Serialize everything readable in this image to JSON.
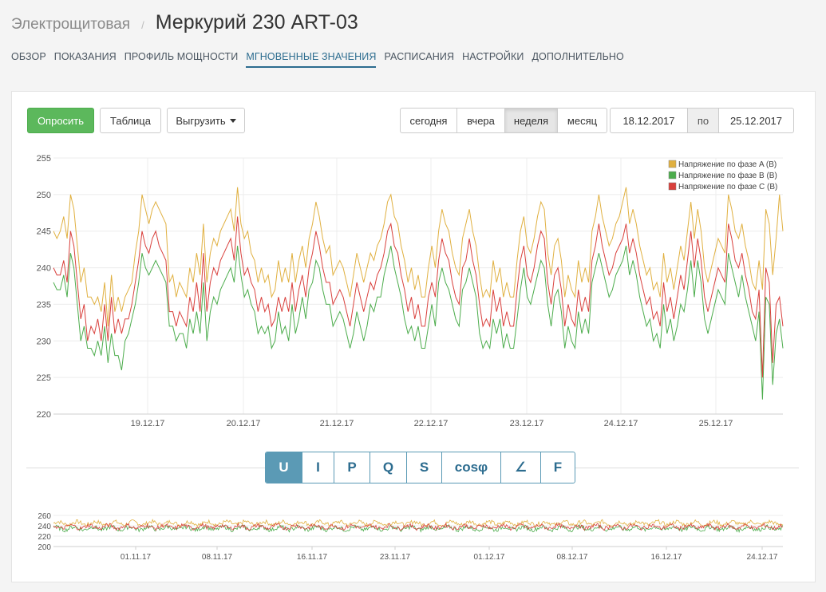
{
  "breadcrumb": {
    "parent": "Электрощитовая",
    "separator": "/",
    "title": "Меркурий 230 ART-03"
  },
  "tabs": [
    {
      "label": "ОБЗОР",
      "active": false
    },
    {
      "label": "ПОКАЗАНИЯ",
      "active": false
    },
    {
      "label": "ПРОФИЛЬ МОЩНОСТИ",
      "active": false
    },
    {
      "label": "МГНОВЕННЫЕ ЗНАЧЕНИЯ",
      "active": true
    },
    {
      "label": "РАСПИСАНИЯ",
      "active": false
    },
    {
      "label": "НАСТРОЙКИ",
      "active": false
    },
    {
      "label": "ДОПОЛНИТЕЛЬНО",
      "active": false
    }
  ],
  "toolbar": {
    "request_label": "Опросить",
    "table_label": "Таблица",
    "export_label": "Выгрузить"
  },
  "period": {
    "options": [
      "сегодня",
      "вчера",
      "неделя",
      "месяц"
    ],
    "selected": "неделя",
    "from": "18.12.2017",
    "to_label": "по",
    "to": "25.12.2017"
  },
  "params": {
    "items": [
      "U",
      "I",
      "P",
      "Q",
      "S",
      "cosφ",
      "∠",
      "F"
    ],
    "selected": "U"
  },
  "colors": {
    "phase_a": "#e0b040",
    "phase_b": "#4cac4c",
    "phase_c": "#d9403c",
    "accent": "#5b9ab5",
    "primary": "#5cb85c"
  },
  "chart_data": [
    {
      "type": "line",
      "ylim": [
        220,
        255
      ],
      "y_ticks": [
        220,
        225,
        230,
        235,
        240,
        245,
        250,
        255
      ],
      "x_ticks": [
        "19.12.17",
        "20.12.17",
        "21.12.17",
        "22.12.17",
        "23.12.17",
        "24.12.17",
        "25.12.17"
      ],
      "legend_position": "top-right",
      "grid": true,
      "series": [
        {
          "name": "Напряжение по фазе A (В)",
          "color": "#e0b040",
          "values": [
            245,
            244,
            245,
            247,
            244,
            250,
            248,
            243,
            238,
            240,
            236,
            236,
            235,
            236,
            234,
            238,
            232,
            239,
            234,
            236,
            234,
            236,
            237,
            238,
            242,
            245,
            250,
            248,
            246,
            248,
            249,
            248,
            247,
            246,
            238,
            239,
            236,
            238,
            237,
            236,
            240,
            238,
            242,
            239,
            246,
            238,
            242,
            244,
            243,
            245,
            246,
            247,
            248,
            245,
            251,
            246,
            244,
            245,
            242,
            241,
            238,
            240,
            238,
            239,
            236,
            237,
            241,
            238,
            240,
            238,
            242,
            238,
            241,
            243,
            240,
            244,
            246,
            249,
            247,
            244,
            242,
            243,
            239,
            240,
            241,
            240,
            238,
            236,
            239,
            242,
            240,
            238,
            240,
            242,
            241,
            243,
            244,
            246,
            249,
            250,
            247,
            246,
            243,
            241,
            238,
            240,
            237,
            239,
            236,
            236,
            240,
            243,
            240,
            245,
            248,
            246,
            245,
            242,
            240,
            239,
            244,
            246,
            248,
            245,
            243,
            239,
            236,
            237,
            236,
            241,
            238,
            240,
            236,
            238,
            236,
            236,
            241,
            245,
            247,
            243,
            242,
            244,
            247,
            249,
            248,
            242,
            239,
            243,
            244,
            241,
            236,
            239,
            237,
            236,
            241,
            238,
            240,
            238,
            245,
            247,
            250,
            247,
            245,
            243,
            244,
            246,
            247,
            249,
            251,
            246,
            248,
            246,
            243,
            241,
            239,
            240,
            237,
            238,
            236,
            242,
            238,
            240,
            237,
            240,
            243,
            241,
            245,
            249,
            244,
            248,
            245,
            240,
            238,
            240,
            242,
            244,
            243,
            242,
            250,
            248,
            245,
            244,
            246,
            243,
            241,
            238,
            237,
            241,
            237,
            248,
            246,
            239,
            244,
            250,
            245
          ]
        },
        {
          "name": "Напряжение по фазе B (В)",
          "color": "#4cac4c",
          "values": [
            238,
            237,
            237,
            239,
            236,
            242,
            240,
            235,
            230,
            232,
            229,
            229,
            228,
            230,
            228,
            232,
            227,
            231,
            228,
            228,
            226,
            230,
            231,
            233,
            235,
            238,
            242,
            240,
            239,
            240,
            241,
            240,
            239,
            238,
            232,
            232,
            230,
            231,
            231,
            229,
            233,
            231,
            234,
            231,
            238,
            230,
            234,
            236,
            235,
            237,
            238,
            239,
            240,
            238,
            243,
            239,
            236,
            237,
            235,
            234,
            231,
            232,
            231,
            232,
            229,
            230,
            234,
            231,
            232,
            230,
            235,
            231,
            233,
            236,
            233,
            237,
            238,
            241,
            240,
            237,
            235,
            235,
            232,
            233,
            234,
            233,
            231,
            229,
            231,
            234,
            232,
            230,
            232,
            235,
            234,
            236,
            236,
            239,
            241,
            243,
            240,
            238,
            236,
            233,
            231,
            232,
            230,
            232,
            229,
            229,
            232,
            235,
            232,
            238,
            240,
            238,
            237,
            235,
            233,
            232,
            237,
            238,
            240,
            238,
            236,
            231,
            229,
            230,
            229,
            233,
            231,
            233,
            229,
            231,
            229,
            229,
            233,
            237,
            240,
            236,
            235,
            237,
            239,
            241,
            240,
            235,
            232,
            236,
            237,
            234,
            229,
            232,
            230,
            229,
            234,
            231,
            233,
            231,
            238,
            240,
            242,
            240,
            238,
            236,
            237,
            239,
            240,
            241,
            243,
            239,
            241,
            239,
            236,
            234,
            232,
            233,
            230,
            231,
            229,
            235,
            231,
            233,
            230,
            232,
            235,
            234,
            237,
            241,
            236,
            241,
            238,
            233,
            231,
            233,
            235,
            237,
            236,
            235,
            242,
            240,
            238,
            236,
            239,
            236,
            234,
            232,
            230,
            234,
            222,
            236,
            235,
            224,
            231,
            233,
            229
          ]
        },
        {
          "name": "Напряжение по фазе C (В)",
          "color": "#d9403c",
          "values": [
            240,
            239,
            239,
            241,
            238,
            245,
            243,
            238,
            233,
            235,
            230,
            232,
            231,
            233,
            230,
            235,
            230,
            236,
            231,
            233,
            231,
            233,
            233,
            235,
            238,
            241,
            245,
            243,
            242,
            244,
            245,
            243,
            242,
            241,
            234,
            234,
            232,
            234,
            233,
            232,
            236,
            234,
            238,
            234,
            242,
            234,
            238,
            240,
            239,
            241,
            242,
            243,
            244,
            241,
            247,
            242,
            239,
            240,
            238,
            237,
            234,
            236,
            234,
            235,
            232,
            233,
            236,
            234,
            236,
            234,
            238,
            234,
            237,
            239,
            236,
            240,
            242,
            245,
            243,
            240,
            238,
            238,
            235,
            236,
            237,
            236,
            234,
            232,
            235,
            238,
            236,
            234,
            236,
            238,
            237,
            239,
            240,
            242,
            245,
            246,
            243,
            242,
            239,
            237,
            234,
            236,
            233,
            235,
            232,
            232,
            236,
            238,
            236,
            241,
            244,
            242,
            241,
            238,
            236,
            235,
            240,
            241,
            244,
            241,
            239,
            235,
            232,
            233,
            232,
            237,
            234,
            236,
            232,
            234,
            232,
            232,
            237,
            241,
            243,
            239,
            238,
            240,
            243,
            245,
            244,
            238,
            235,
            239,
            240,
            237,
            232,
            235,
            233,
            232,
            237,
            234,
            236,
            234,
            241,
            243,
            246,
            243,
            241,
            239,
            240,
            242,
            243,
            244,
            246,
            242,
            244,
            242,
            239,
            237,
            235,
            236,
            233,
            234,
            232,
            238,
            234,
            236,
            233,
            236,
            239,
            237,
            241,
            245,
            240,
            244,
            241,
            236,
            234,
            236,
            238,
            240,
            239,
            238,
            246,
            244,
            241,
            240,
            242,
            239,
            237,
            234,
            233,
            237,
            225,
            240,
            238,
            227,
            235,
            236,
            232
          ]
        }
      ]
    },
    {
      "type": "line",
      "ylim": [
        200,
        260
      ],
      "y_ticks": [
        200,
        220,
        240,
        260
      ],
      "x_ticks": [
        "01.11.17",
        "08.11.17",
        "16.11.17",
        "23.11.17",
        "01.12.17",
        "08.12.17",
        "16.12.17",
        "24.12.17"
      ],
      "series": [
        {
          "name": "Напряжение по фазе A (В)",
          "color": "#e0b040",
          "values": [
            245
          ]
        },
        {
          "name": "Напряжение по фазе B (В)",
          "color": "#4cac4c",
          "values": [
            235
          ]
        },
        {
          "name": "Напряжение по фазе C (В)",
          "color": "#d9403c",
          "values": [
            238
          ]
        }
      ]
    }
  ]
}
